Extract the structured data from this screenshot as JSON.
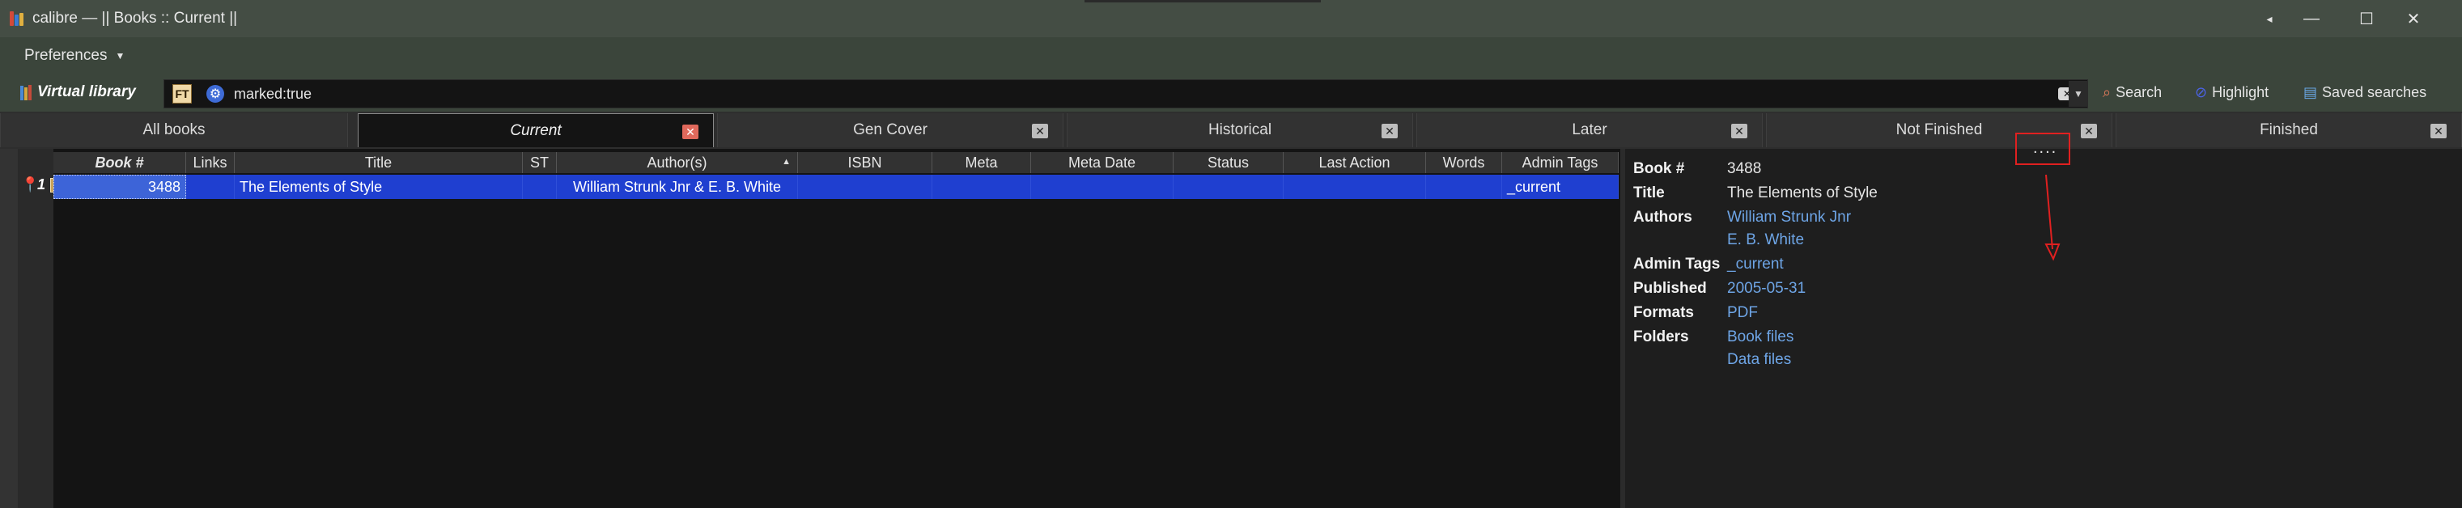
{
  "window": {
    "title": "calibre — || Books :: Current ||",
    "controls": [
      "◂",
      "—",
      "☐",
      "✕"
    ]
  },
  "menu": {
    "preferences": "Preferences"
  },
  "searchbar": {
    "virtual_library": "Virtual library",
    "ft_label": "FT",
    "query": "marked:true",
    "search_label": "Search",
    "highlight_label": "Highlight",
    "saved_searches_label": "Saved searches"
  },
  "tabs": [
    {
      "label": "All books",
      "active": false,
      "closable": false
    },
    {
      "label": "Current",
      "active": true,
      "closable": true
    },
    {
      "label": "Gen Cover",
      "active": false,
      "closable": true
    },
    {
      "label": "Historical",
      "active": false,
      "closable": true
    },
    {
      "label": "Later",
      "active": false,
      "closable": true
    },
    {
      "label": "Not Finished",
      "active": false,
      "closable": true
    },
    {
      "label": "Finished",
      "active": false,
      "closable": true
    }
  ],
  "table": {
    "columns": [
      "Book #",
      "Links",
      "Title",
      "ST",
      "Author(s)",
      "ISBN",
      "Meta",
      "Meta Date",
      "Status",
      "Last Action",
      "Words",
      "Admin Tags"
    ],
    "rows": [
      {
        "row_number": "1",
        "cells": [
          "3488",
          "",
          "The Elements of Style",
          "",
          "William Strunk Jnr & E. B. White",
          "",
          "",
          "",
          "",
          "",
          "",
          "_current"
        ]
      }
    ]
  },
  "details": {
    "book_num_label": "Book #",
    "book_num": "3488",
    "title_label": "Title",
    "title": "The Elements of Style",
    "authors_label": "Authors",
    "author_1": "William Strunk Jnr",
    "author_2": "E. B. White",
    "admin_tags_label": "Admin Tags",
    "admin_tags": "_current",
    "published_label": "Published",
    "published": "2005-05-31",
    "formats_label": "Formats",
    "formats": "PDF",
    "folders_label": "Folders",
    "folder_1": "Book files",
    "folder_2": "Data files"
  },
  "annotation": {
    "handle": "....",
    "color": "#e02020"
  },
  "colors": {
    "titlebar": "#444d44",
    "toolbar": "#3b453b",
    "selection": "#1f3fd0",
    "link": "#6ea5e6"
  }
}
